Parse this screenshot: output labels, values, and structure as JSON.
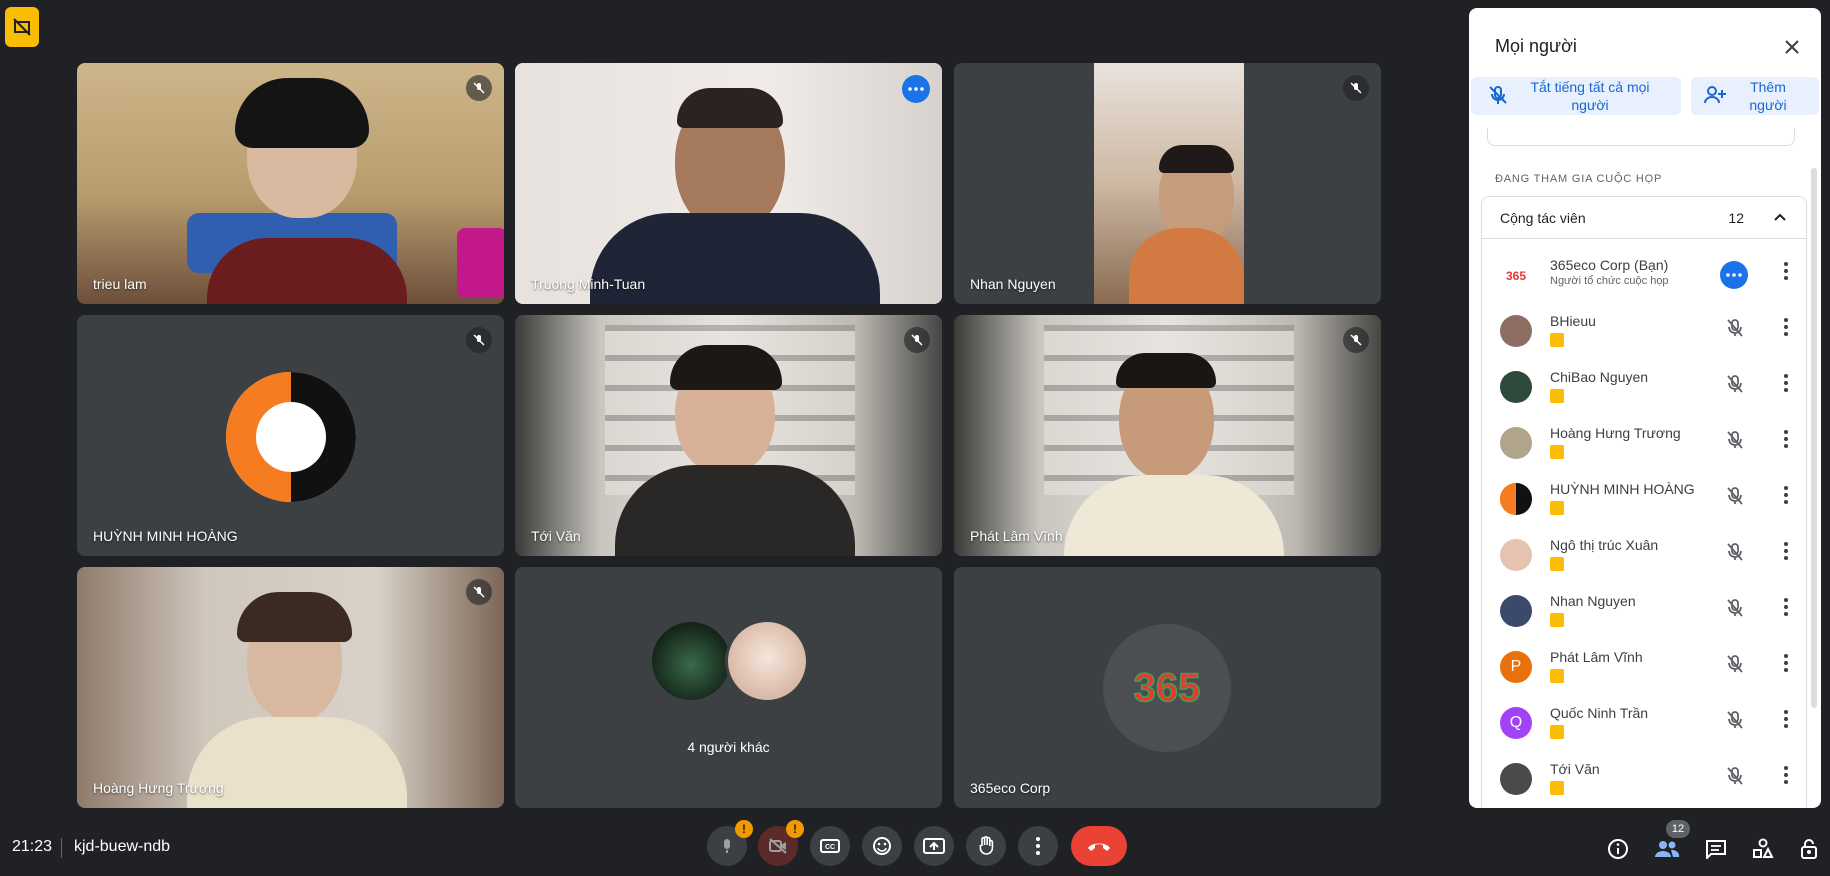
{
  "meeting": {
    "time": "21:23",
    "code": "kjd-buew-ndb"
  },
  "tiles": [
    {
      "name": "trieu lam",
      "muted": true
    },
    {
      "name": "Truong Minh-Tuan",
      "active": true
    },
    {
      "name": "Nhan Nguyen",
      "muted": true
    },
    {
      "name": "HUỲNH MINH HOÀNG",
      "muted": true
    },
    {
      "name": "Tới Văn",
      "muted": true
    },
    {
      "name": "Phát Lâm Vĩnh",
      "muted": true
    },
    {
      "name": "Hoàng Hưng Trương",
      "muted": true
    },
    {
      "name": "4 người khác"
    },
    {
      "name": "365eco Corp"
    }
  ],
  "panel": {
    "title": "Mọi người",
    "mute_all_label": "Tắt tiếng tất cả mọi người",
    "add_label": "Thêm người",
    "section_label": "ĐANG THAM GIA CUỘC HỌP",
    "group_title": "Cộng tác viên",
    "group_count": "12",
    "participants": [
      {
        "name": "365eco Corp (Bạn)",
        "subtitle": "Người tổ chức cuộc họp",
        "avatar": "logo-365",
        "color": "#ffffff"
      },
      {
        "name": "BHieuu",
        "avatar": "photo",
        "color": "#8d6e63"
      },
      {
        "name": "ChiBao Nguyen",
        "avatar": "photo",
        "color": "#2e4a3a"
      },
      {
        "name": "Hoàng Hưng Trương",
        "avatar": "photo",
        "color": "#b0a48a"
      },
      {
        "name": "HUỲNH MINH HOÀNG",
        "avatar": "fox",
        "color": "#f57c20"
      },
      {
        "name": "Ngô thị trúc Xuân",
        "avatar": "photo",
        "color": "#e6c3b0"
      },
      {
        "name": "Nhan Nguyen",
        "avatar": "photo",
        "color": "#3b4a6b"
      },
      {
        "name": "Phát Lâm Vĩnh",
        "avatar": "letter",
        "letter": "P",
        "color": "#e8710a"
      },
      {
        "name": "Quốc Ninh Trần",
        "avatar": "letter",
        "letter": "Q",
        "color": "#a142f4"
      },
      {
        "name": "Tới Văn",
        "avatar": "photo",
        "color": "#4a4a4a"
      }
    ]
  },
  "participant_count_badge": "12",
  "colors": {
    "accent": "#1a73e8",
    "end_call": "#ea4335",
    "warning": "#f29900",
    "badge": "#fbbc04"
  }
}
